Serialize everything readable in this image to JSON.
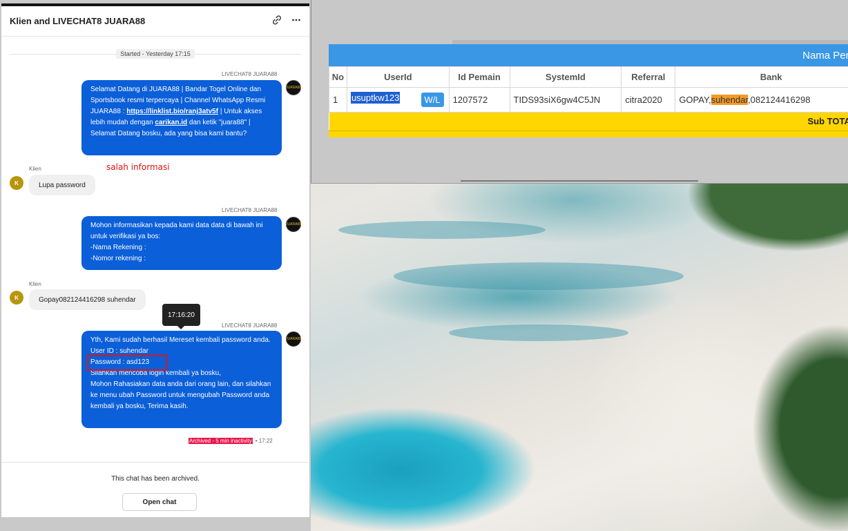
{
  "chat": {
    "title": "Klien and LIVECHAT8 JUARA88",
    "started": "Started - Yesterday 17:15",
    "agent_name": "LIVECHAT8 JUARA88",
    "client_name": "Klien",
    "client_initial": "K",
    "agent_avatar_text": "JUARA88",
    "msg1": {
      "a": "Selamat Datang di JUARA88 | Bandar Togel Online dan Sportsbook resmi terpercaya | Channel WhatsApp Resmi JUARA88 : ",
      "link1": "https://linklist.bio/ranj3atv5f",
      "b": " | Untuk akses lebih mudah dengan ",
      "link2": "carikan.id",
      "c": " dan ketik \"juara88\" | Selamat Datang bosku, ada yang bisa kami bantu?"
    },
    "client_msg1": "Lupa password",
    "annotation": "salah informasi",
    "msg2": {
      "l1": "Mohon informasikan kepada kami data data di bawah ini untuk verifikasi ya bos:",
      "l2": "-Nama Rekening :",
      "l3": "-Nomor rekening :"
    },
    "client_msg2": "Gopay082124416298 suhendar",
    "tooltip": "17:16:20",
    "msg3": {
      "l1": "Yth, Kami sudah berhasil Mereset kembali password anda.",
      "l2": "User ID : suhendar",
      "l3": "Password : asd123",
      "l4": "Silahkan mencoba login kembali ya bosku,",
      "l5": "Mohon Rahasiakan data anda dari orang lain, dan silahkan ke menu ubah Password untuk mengubah Password anda kembali ya bosku, Terima kasih."
    },
    "archived_tag": "Archived - 5 min inactivity",
    "archived_time": "• 17:22",
    "archived_msg": "This chat has been archived.",
    "open_chat": "Open chat",
    "icons": [
      "link-icon",
      "more-icon"
    ]
  },
  "admin": {
    "header_title": "Nama Pen",
    "columns": [
      "No",
      "UserId",
      "Id Pemain",
      "SystemId",
      "Referral",
      "Bank"
    ],
    "row": {
      "no": "1",
      "userid": "usuptkw123",
      "wl": "W/L",
      "id_pemain": "1207572",
      "system_id": "TIDS93siX6gw4C5JN",
      "referral": "citra2020",
      "bank_a": "GOPAY,",
      "bank_hl": "suhendar",
      "bank_b": ",082124416298"
    },
    "subtotal": "Sub TOTAL :"
  },
  "colors": {
    "agent_bubble": "#0b5fd8",
    "table_header": "#3a97e6",
    "subtotal": "#ffd600",
    "highlight": "#f39a2a",
    "annotation": "#dd1111"
  }
}
